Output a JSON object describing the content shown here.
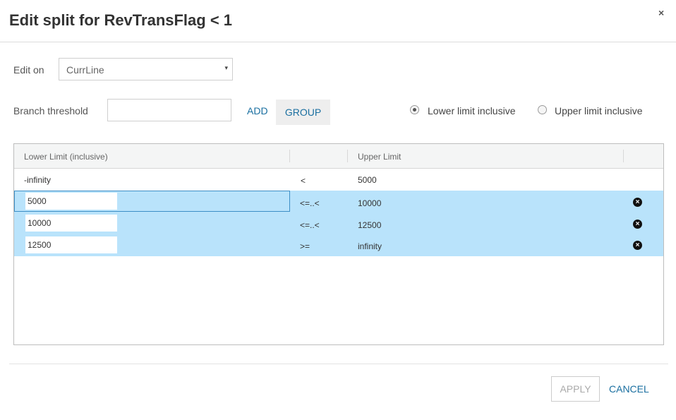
{
  "dialog": {
    "title": "Edit split for RevTransFlag < 1",
    "close_glyph": "×"
  },
  "edit_on": {
    "label": "Edit on",
    "selected": "CurrLine",
    "caret": "▾"
  },
  "branch": {
    "label": "Branch threshold",
    "value": "",
    "add_label": "ADD",
    "group_label": "GROUP"
  },
  "inclusive": {
    "lower_label": "Lower limit inclusive",
    "upper_label": "Upper limit inclusive",
    "selected": "lower"
  },
  "grid": {
    "headers": [
      "Lower Limit (inclusive)",
      "",
      "Upper Limit",
      ""
    ],
    "rows": [
      {
        "lower": "-infinity",
        "op": "<",
        "upper": "5000",
        "editable": false
      },
      {
        "lower": "5000",
        "op": "<=..<",
        "upper": "10000",
        "editable": true
      },
      {
        "lower": "10000",
        "op": "<=..<",
        "upper": "12500",
        "editable": true
      },
      {
        "lower": "12500",
        "op": ">=",
        "upper": "infinity",
        "editable": true
      }
    ],
    "delete_icon": "delete-circle-icon"
  },
  "footer": {
    "apply_label": "APPLY",
    "cancel_label": "CANCEL"
  },
  "colors": {
    "accent": "#1a6fa0",
    "selected_row": "#b9e3fb",
    "focus_border": "#3d8fc6"
  }
}
